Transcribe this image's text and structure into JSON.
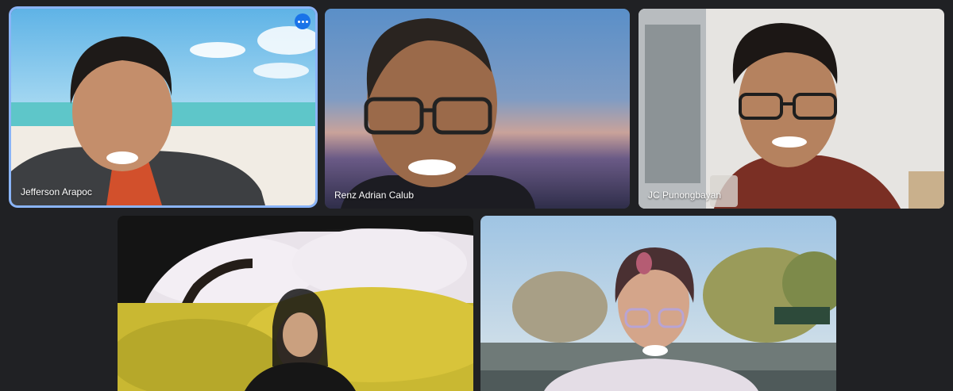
{
  "participants": [
    {
      "name": "Jefferson Arapoc"
    },
    {
      "name": "Renz Adrian Calub"
    },
    {
      "name": "JC Punongbayan"
    },
    {
      "name": ""
    },
    {
      "name": ""
    }
  ],
  "colors": {
    "accent": "#8ab4f8",
    "more_button": "#1a73e8",
    "background": "#202124"
  },
  "icons": {
    "tile_menu": "more-horiz-icon"
  }
}
